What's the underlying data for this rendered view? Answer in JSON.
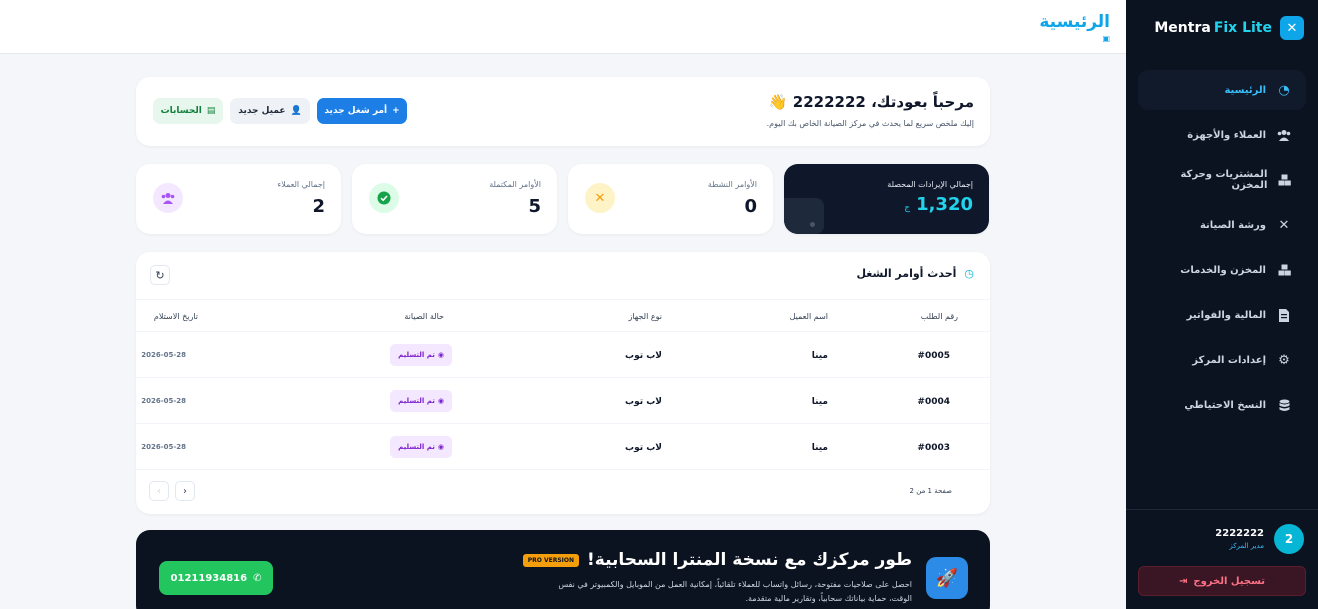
{
  "brand": {
    "name": "Mentra",
    "accent": "Fix Lite"
  },
  "nav": [
    {
      "label": "الرئيسية",
      "icon": "pie-chart-icon"
    },
    {
      "label": "العملاء والأجهزة",
      "icon": "users-icon"
    },
    {
      "label": "المشتريات وحركة المخزن",
      "icon": "boxes-icon"
    },
    {
      "label": "ورشة الصيانة",
      "icon": "tools-icon"
    },
    {
      "label": "المخزن والخدمات",
      "icon": "boxes-icon"
    },
    {
      "label": "المالية والفواتير",
      "icon": "invoice-icon"
    },
    {
      "label": "إعدادات المركز",
      "icon": "gear-icon"
    },
    {
      "label": "النسخ الاحتياطي",
      "icon": "database-icon"
    }
  ],
  "user": {
    "name": "2222222",
    "role": "مدير المركز",
    "initial": "2",
    "logout": "تسجيل الخروج"
  },
  "header": {
    "title": "الرئيسية"
  },
  "welcome": {
    "title": "مرحباً بعودتك، 2222222 👋",
    "subtitle": "إليك ملخص سريع لما يحدث في مركز الصيانة الخاص بك اليوم.",
    "btn_new_order": "أمر شغل جديد",
    "btn_new_client": "عميل جديد",
    "btn_accounts": "الحسابات"
  },
  "stats": {
    "revenue": {
      "label": "إجمالي الإيرادات المحصلة",
      "value": "1,320",
      "currency": "ج"
    },
    "active": {
      "label": "الأوامر النشطة",
      "value": "0"
    },
    "completed": {
      "label": "الأوامر المكتملة",
      "value": "5"
    },
    "clients": {
      "label": "إجمالي العملاء",
      "value": "2"
    }
  },
  "orders": {
    "title": "أحدث أوامر الشغل",
    "columns": {
      "id": "رقم الطلب",
      "client": "اسم العميل",
      "device": "نوع الجهاز",
      "status": "حالة الصيانة",
      "date": "تاريخ الاستلام"
    },
    "rows": [
      {
        "id": "#0005",
        "client": "مينا",
        "device": "لاب توب",
        "status": "تم التسليم",
        "date": "2026-05-28"
      },
      {
        "id": "#0004",
        "client": "مينا",
        "device": "لاب توب",
        "status": "تم التسليم",
        "date": "2026-05-28"
      },
      {
        "id": "#0003",
        "client": "مينا",
        "device": "لاب توب",
        "status": "تم التسليم",
        "date": "2026-05-28"
      }
    ],
    "pagination": "صفحة 1 من 2"
  },
  "promo": {
    "title": "طور مركزك مع نسخة المنترا السحابية!",
    "badge": "PRO VERSION",
    "description": "احصل على صلاحيات مفتوحة، رسائل واتساب للعملاء تلقائياً، إمكانية العمل من الموبايل والكمبيوتر في نفس الوقت، حماية بياناتك سحابياً، وتقارير مالية متقدمة.",
    "phone": "01211934816"
  }
}
